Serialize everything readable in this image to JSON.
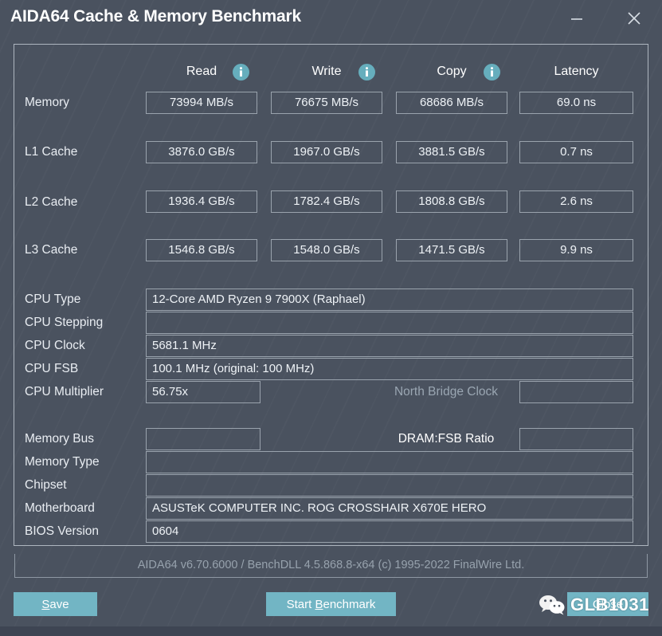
{
  "window": {
    "title": "AIDA64 Cache & Memory Benchmark",
    "minimize_icon": "minimize-icon",
    "close_icon": "close-icon"
  },
  "columns": {
    "read": "Read",
    "write": "Write",
    "copy": "Copy",
    "latency": "Latency",
    "info_icon": "info-icon"
  },
  "benchmark_rows": [
    {
      "label": "Memory",
      "read": "73994 MB/s",
      "write": "76675 MB/s",
      "copy": "68686 MB/s",
      "latency": "69.0 ns"
    },
    {
      "label": "L1 Cache",
      "read": "3876.0 GB/s",
      "write": "1967.0 GB/s",
      "copy": "3881.5 GB/s",
      "latency": "0.7 ns"
    },
    {
      "label": "L2 Cache",
      "read": "1936.4 GB/s",
      "write": "1782.4 GB/s",
      "copy": "1808.8 GB/s",
      "latency": "2.6 ns"
    },
    {
      "label": "L3 Cache",
      "read": "1546.8 GB/s",
      "write": "1548.0 GB/s",
      "copy": "1471.5 GB/s",
      "latency": "9.9 ns"
    }
  ],
  "cpu_info": {
    "type_label": "CPU Type",
    "type_value": "12-Core AMD Ryzen 9 7900X  (Raphael)",
    "stepping_label": "CPU Stepping",
    "stepping_value": "",
    "clock_label": "CPU Clock",
    "clock_value": "5681.1 MHz",
    "fsb_label": "CPU FSB",
    "fsb_value": "100.1 MHz  (original: 100 MHz)",
    "multiplier_label": "CPU Multiplier",
    "multiplier_value": "56.75x",
    "north_bridge_label": "North Bridge Clock",
    "north_bridge_value": ""
  },
  "memory_info": {
    "bus_label": "Memory Bus",
    "bus_value": "",
    "dram_ratio_label": "DRAM:FSB Ratio",
    "dram_ratio_value": "",
    "type_label": "Memory Type",
    "type_value": "",
    "chipset_label": "Chipset",
    "chipset_value": "",
    "motherboard_label": "Motherboard",
    "motherboard_value": "ASUSTeK COMPUTER INC. ROG CROSSHAIR X670E HERO",
    "bios_label": "BIOS Version",
    "bios_value": "0604"
  },
  "footer": {
    "copyright": "AIDA64 v6.70.6000 / BenchDLL 4.5.868.8-x64  (c) 1995-2022 FinalWire Ltd.",
    "save_label_pre": "",
    "save_accel": "S",
    "save_label_post": "ave",
    "start_label_pre": "Start ",
    "start_accel": "B",
    "start_label_post": "enchmark",
    "close_label": "Close"
  },
  "watermark": {
    "icon": "wechat-icon",
    "text": "GLB1031"
  },
  "colors": {
    "background": "#4a525f",
    "accent_teal": "#72b5c4",
    "info_icon": "#66aebd",
    "border": "#9aa3ad",
    "text": "#e9edf2",
    "dim_text": "#9aa6b2"
  }
}
